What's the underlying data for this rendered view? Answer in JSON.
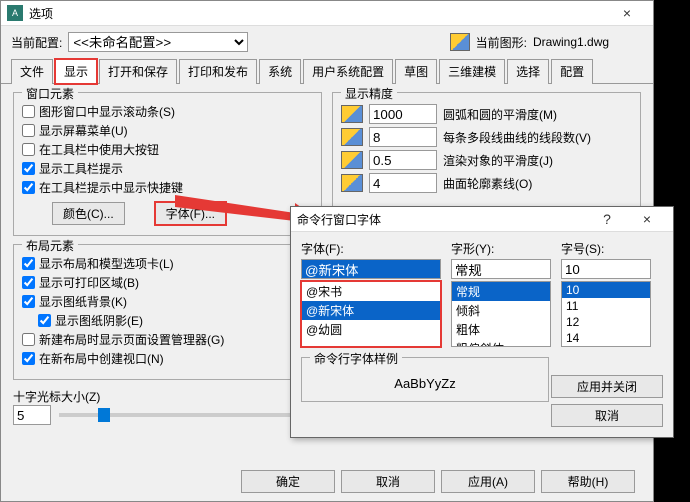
{
  "main": {
    "title": "选项",
    "close": "×",
    "cfg_label": "当前配置:",
    "cfg_value": "<<未命名配置>>",
    "drawing_label": "当前图形:",
    "drawing_value": "Drawing1.dwg",
    "tabs": [
      "文件",
      "显示",
      "打开和保存",
      "打印和发布",
      "系统",
      "用户系统配置",
      "草图",
      "三维建模",
      "选择",
      "配置"
    ],
    "win_elem": {
      "legend": "窗口元素",
      "c0": "图形窗口中显示滚动条(S)",
      "c1": "显示屏幕菜单(U)",
      "c2": "在工具栏中使用大按钮",
      "c3": "显示工具栏提示",
      "c4": "在工具栏提示中显示快捷键",
      "btn_color": "颜色(C)...",
      "btn_font": "字体(F)..."
    },
    "layout": {
      "legend": "布局元素",
      "c0": "显示布局和模型选项卡(L)",
      "c1": "显示可打印区域(B)",
      "c2": "显示图纸背景(K)",
      "c3": "显示图纸阴影(E)",
      "c4": "新建布局时显示页面设置管理器(G)",
      "c5": "在新布局中创建视口(N)"
    },
    "cross": {
      "label": "十字光标大小(Z)",
      "value": "5"
    },
    "precision": {
      "legend": "显示精度",
      "r0": {
        "v": "1000",
        "t": "圆弧和圆的平滑度(M)"
      },
      "r1": {
        "v": "8",
        "t": "每条多段线曲线的线段数(V)"
      },
      "r2": {
        "v": "0.5",
        "t": "渲染对象的平滑度(J)"
      },
      "r3": {
        "v": "4",
        "t": "曲面轮廓素线(O)"
      }
    },
    "buttons": {
      "ok": "确定",
      "cancel": "取消",
      "apply": "应用(A)",
      "help": "帮助(H)"
    }
  },
  "font": {
    "title": "命令行窗口字体",
    "help": "?",
    "close": "×",
    "font_label": "字体(F):",
    "font_value": "@新宋体",
    "font_list": [
      "@宋书",
      "@新宋体",
      "@幼圆"
    ],
    "style_label": "字形(Y):",
    "style_value": "常规",
    "style_list": [
      "常规",
      "倾斜",
      "粗体",
      "粗偏斜体"
    ],
    "size_label": "字号(S):",
    "size_value": "10",
    "size_list": [
      "10",
      "11",
      "12",
      "14"
    ],
    "sample_legend": "命令行字体样例",
    "sample_text": "AaBbYyZz",
    "btn_apply": "应用并关闭",
    "btn_cancel": "取消"
  }
}
